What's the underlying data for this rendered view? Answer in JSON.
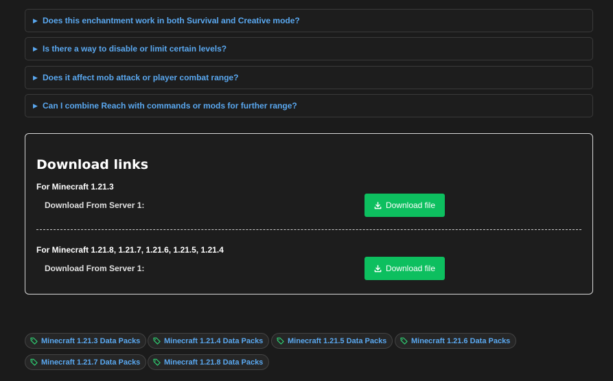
{
  "faq": [
    {
      "question": "Does this enchantment work in both Survival and Creative mode?"
    },
    {
      "question": "Is there a way to disable or limit certain levels?"
    },
    {
      "question": "Does it affect mob attack or player combat range?"
    },
    {
      "question": "Can I combine Reach with commands or mods for further range?"
    }
  ],
  "downloads": {
    "title": "Download links",
    "sections": [
      {
        "version_title": "For Minecraft 1.21.3",
        "server_label": "Download From Server 1:",
        "button_label": "Download file"
      },
      {
        "version_title": "For Minecraft 1.21.8, 1.21.7, 1.21.6, 1.21.5, 1.21.4",
        "server_label": "Download From Server 1:",
        "button_label": "Download file"
      }
    ]
  },
  "tags": [
    {
      "label": "Minecraft 1.21.3 Data Packs"
    },
    {
      "label": "Minecraft 1.21.4 Data Packs"
    },
    {
      "label": "Minecraft 1.21.5 Data Packs"
    },
    {
      "label": "Minecraft 1.21.6 Data Packs"
    },
    {
      "label": "Minecraft 1.21.7 Data Packs"
    },
    {
      "label": "Minecraft 1.21.8 Data Packs"
    }
  ],
  "colors": {
    "background": "#1b1b1b",
    "link": "#5aa8f0",
    "download_button": "#0dbf5f",
    "tag_icon": "#2ecc71"
  },
  "icons": {
    "faq_toggle": "triangle-right-icon",
    "download": "download-icon",
    "tag": "tag-icon"
  }
}
